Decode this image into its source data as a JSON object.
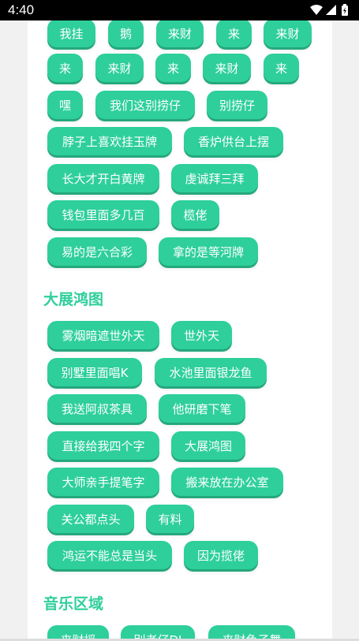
{
  "status_bar": {
    "time": "4:40"
  },
  "sections": {
    "section1_chips": [
      "我挂",
      "鹅",
      "来财",
      "来",
      "来财",
      "来",
      "来财",
      "来",
      "来财",
      "来",
      "嘿",
      "我们这别捞仔",
      "别捞仔",
      "脖子上喜欢挂玉牌",
      "香炉供台上摆",
      "长大才开白黄牌",
      "虔诚拜三拜",
      "钱包里面多几百",
      "榄佬",
      "易的是六合彩",
      "拿的是等河牌"
    ],
    "section2_title": "大展鸿图",
    "section2_chips": [
      "雾烟暗遮世外天",
      "世外天",
      "别墅里面唱K",
      "水池里面银龙鱼",
      "我送阿叔茶具",
      "他研磨下笔",
      "直接给我四个字",
      "大展鸿图",
      "大师亲手提笔字",
      "搬来放在办公室",
      "关公都点头",
      "有料",
      "鸿运不能总是当头",
      "因为揽佬"
    ],
    "section3_title": "音乐区域",
    "section3_chips": [
      "来财摇",
      "别老仔DJ",
      "来财鱼子舞"
    ]
  }
}
